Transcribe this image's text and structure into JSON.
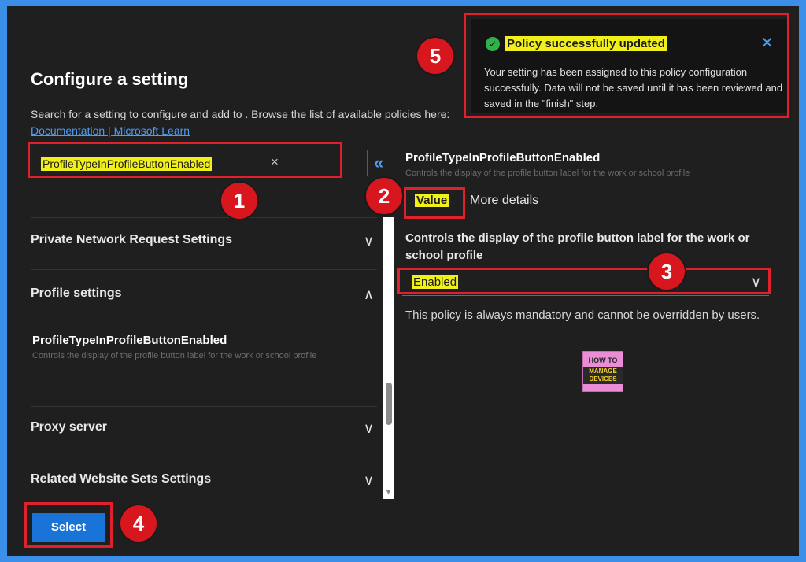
{
  "header": {
    "title": "Configure a setting",
    "description": "Search for a setting to configure and add to . Browse the list of available policies here:",
    "doc_link": "Documentation | Microsoft Learn"
  },
  "search": {
    "value": "ProfileTypeInProfileButtonEnabled",
    "clear_icon": "×"
  },
  "collapse_icon": "«",
  "categories": [
    {
      "label": "Private Network Request Settings",
      "chevron": "∨"
    },
    {
      "label": "Profile settings",
      "chevron": "∧"
    },
    {
      "label": "Proxy server",
      "chevron": "∨"
    },
    {
      "label": "Related Website Sets Settings",
      "chevron": "∨"
    }
  ],
  "setting_item": {
    "name": "ProfileTypeInProfileButtonEnabled",
    "description": "Controls the display of the profile button label for the work or school profile"
  },
  "footer": {
    "select_label": "Select"
  },
  "detail": {
    "title": "ProfileTypeInProfileButtonEnabled",
    "subtitle": "Controls the display of the profile button label for the work or school profile",
    "tabs": {
      "value": "Value",
      "more": "More details"
    },
    "field_label": "Controls the display of the profile button label for the work or school profile",
    "dropdown_value": "Enabled",
    "dropdown_chevron": "∨",
    "note": "This policy is always mandatory and cannot be overridden by users."
  },
  "logo": {
    "line1": "HOW TO",
    "line2": "MANAGE DEVICES"
  },
  "toast": {
    "title": "Policy successfully updated",
    "body": "Your setting has been assigned to this policy configuration successfully. Data will not be saved until it has been reviewed and saved in the \"finish\" step.",
    "check_icon": "✓",
    "close_icon": "✕"
  },
  "annotations": {
    "b1": "1",
    "b2": "2",
    "b3": "3",
    "b4": "4",
    "b5": "5"
  },
  "colors": {
    "highlight": "#f2f01a",
    "annotation_red": "#e0202a",
    "accent_blue": "#1a73d6",
    "frame_blue": "#3b8fe8"
  }
}
